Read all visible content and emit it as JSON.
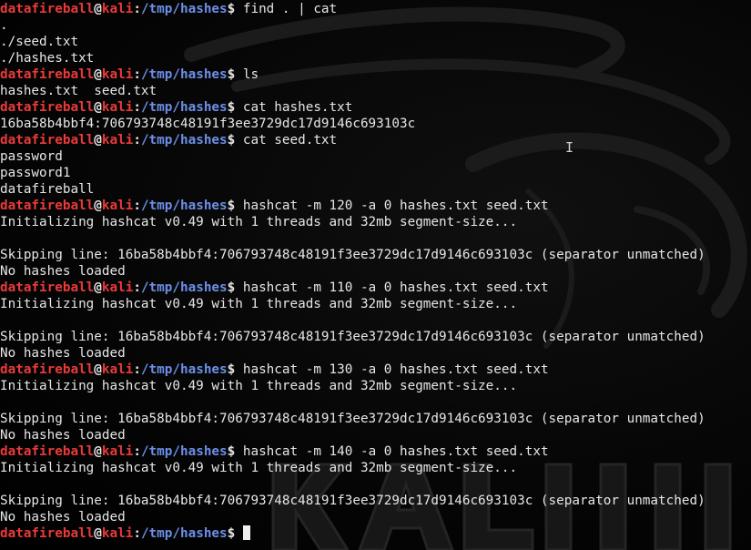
{
  "prompt": {
    "user": "datafireball",
    "at": "@",
    "host": "kali",
    "colon": ":",
    "path": "/tmp/hashes",
    "dollar": "$ "
  },
  "lines": [
    {
      "type": "prompt",
      "command": "find . | cat"
    },
    {
      "type": "out",
      "text": "."
    },
    {
      "type": "out",
      "text": "./seed.txt"
    },
    {
      "type": "out",
      "text": "./hashes.txt"
    },
    {
      "type": "prompt",
      "command": "ls"
    },
    {
      "type": "out",
      "text": "hashes.txt  seed.txt"
    },
    {
      "type": "prompt",
      "command": "cat hashes.txt"
    },
    {
      "type": "out",
      "text": "16ba58b4bbf4:706793748c48191f3ee3729dc17d9146c693103c"
    },
    {
      "type": "prompt",
      "command": "cat seed.txt"
    },
    {
      "type": "out",
      "text": "password"
    },
    {
      "type": "out",
      "text": "password1"
    },
    {
      "type": "out",
      "text": "datafireball"
    },
    {
      "type": "prompt",
      "command": "hashcat -m 120 -a 0 hashes.txt seed.txt"
    },
    {
      "type": "out",
      "text": "Initializing hashcat v0.49 with 1 threads and 32mb segment-size..."
    },
    {
      "type": "out",
      "text": ""
    },
    {
      "type": "out",
      "text": "Skipping line: 16ba58b4bbf4:706793748c48191f3ee3729dc17d9146c693103c (separator unmatched)"
    },
    {
      "type": "out",
      "text": "No hashes loaded"
    },
    {
      "type": "prompt",
      "command": "hashcat -m 110 -a 0 hashes.txt seed.txt"
    },
    {
      "type": "out",
      "text": "Initializing hashcat v0.49 with 1 threads and 32mb segment-size..."
    },
    {
      "type": "out",
      "text": ""
    },
    {
      "type": "out",
      "text": "Skipping line: 16ba58b4bbf4:706793748c48191f3ee3729dc17d9146c693103c (separator unmatched)"
    },
    {
      "type": "out",
      "text": "No hashes loaded"
    },
    {
      "type": "prompt",
      "command": "hashcat -m 130 -a 0 hashes.txt seed.txt"
    },
    {
      "type": "out",
      "text": "Initializing hashcat v0.49 with 1 threads and 32mb segment-size..."
    },
    {
      "type": "out",
      "text": ""
    },
    {
      "type": "out",
      "text": "Skipping line: 16ba58b4bbf4:706793748c48191f3ee3729dc17d9146c693103c (separator unmatched)"
    },
    {
      "type": "out",
      "text": "No hashes loaded"
    },
    {
      "type": "prompt",
      "command": "hashcat -m 140 -a 0 hashes.txt seed.txt"
    },
    {
      "type": "out",
      "text": "Initializing hashcat v0.49 with 1 threads and 32mb segment-size..."
    },
    {
      "type": "out",
      "text": ""
    },
    {
      "type": "out",
      "text": "Skipping line: 16ba58b4bbf4:706793748c48191f3ee3729dc17d9146c693103c (separator unmatched)"
    },
    {
      "type": "out",
      "text": "No hashes loaded"
    },
    {
      "type": "prompt",
      "command": "",
      "cursor": true
    }
  ],
  "wallpaper": {
    "brand": "KALI",
    "icons": {
      "dragon": "kali-dragon-icon",
      "pointer": "text-ibeam-cursor-icon"
    }
  },
  "colors": {
    "background": "#000000",
    "text": "#e6e6e6",
    "prompt_user": "#ea3a3a",
    "prompt_path": "#6c8fe8",
    "cursor": "#f0f0f0"
  }
}
